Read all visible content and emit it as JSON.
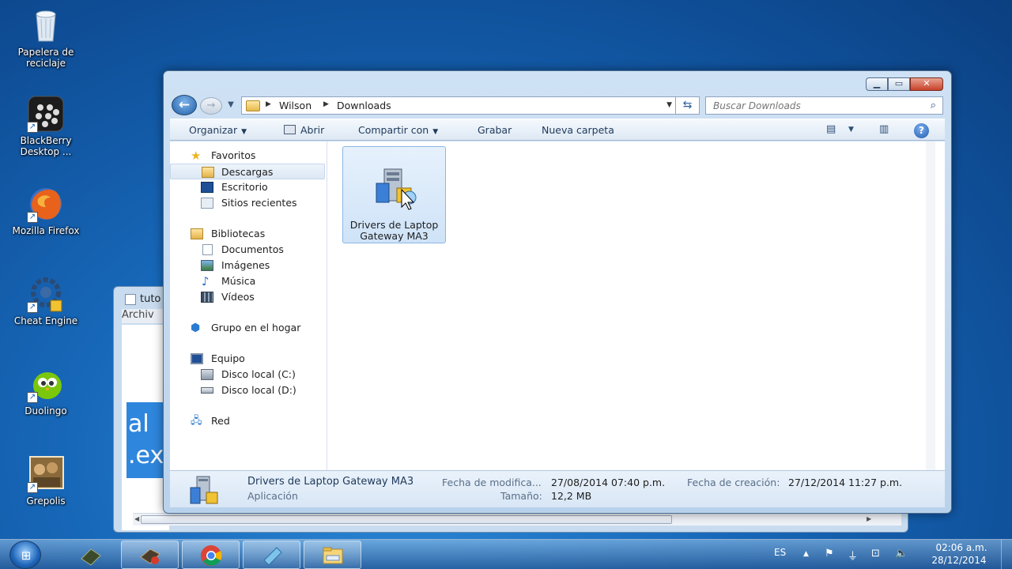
{
  "desktop": {
    "icons": [
      {
        "label": "Papelera de reciclaje",
        "icon": "recycle-bin-icon"
      },
      {
        "label": "BlackBerry Desktop ...",
        "icon": "blackberry-icon"
      },
      {
        "label": "Mozilla Firefox",
        "icon": "firefox-icon"
      },
      {
        "label": "Cheat Engine",
        "icon": "cheat-engine-icon"
      },
      {
        "label": "Duolingo",
        "icon": "duolingo-icon"
      },
      {
        "label": "Grepolis",
        "icon": "grepolis-icon"
      }
    ]
  },
  "bg_window": {
    "title": "tuto",
    "menu": "Archiv",
    "body_text_1": "al",
    "body_text_2": ".ex"
  },
  "explorer": {
    "address": {
      "crumbs": [
        "Wilson",
        "Downloads"
      ]
    },
    "search_placeholder": "Buscar Downloads",
    "toolbar": {
      "organize": "Organizar",
      "open": "Abrir",
      "share": "Compartir con",
      "burn": "Grabar",
      "new_folder": "Nueva carpeta"
    },
    "nav": {
      "favorites": "Favoritos",
      "downloads": "Descargas",
      "desktop": "Escritorio",
      "recent": "Sitios recientes",
      "libraries": "Bibliotecas",
      "documents": "Documentos",
      "images": "Imágenes",
      "music": "Música",
      "videos": "Vídeos",
      "homegroup": "Grupo en el hogar",
      "computer": "Equipo",
      "disk_c": "Disco local (C:)",
      "disk_d": "Disco local (D:)",
      "network": "Red"
    },
    "file": {
      "name": "Drivers de Laptop Gateway MA3"
    },
    "details": {
      "name": "Drivers de Laptop Gateway MA3",
      "type": "Aplicación",
      "modified_label": "Fecha de modifica...",
      "modified_value": "27/08/2014 07:40 p.m.",
      "size_label": "Tamaño:",
      "size_value": "12,2 MB",
      "created_label": "Fecha de creación:",
      "created_value": "27/12/2014 11:27 p.m."
    }
  },
  "taskbar": {
    "language": "ES",
    "time": "02:06 a.m.",
    "date": "28/12/2014"
  },
  "colors": {
    "desktop_blue": "#1767b8",
    "selection": "#cfe3f8",
    "toolbar_text": "#1e395b"
  }
}
